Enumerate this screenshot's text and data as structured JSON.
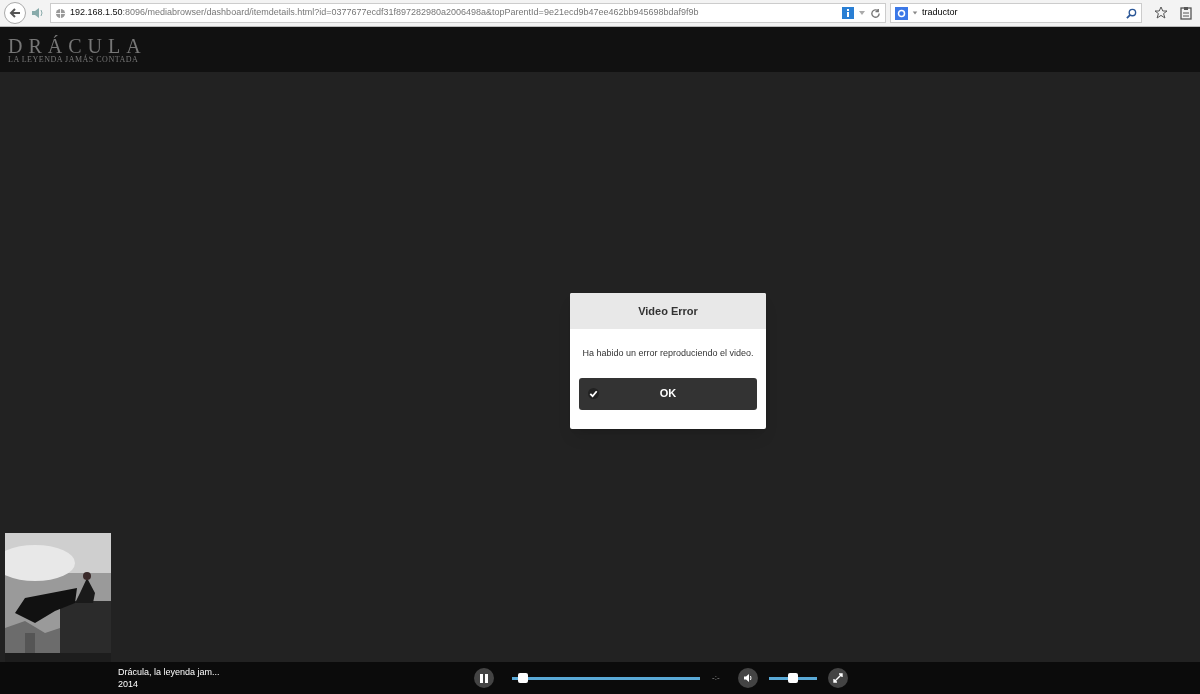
{
  "browser": {
    "url_host": "192.168.1.50",
    "url_rest": ":8096/mediabrowser/dashboard/itemdetails.html?id=0377677ecdf31f897282980a2006498a&topParentId=9e21ecd9b47ee462bb945698bdaf9f9b",
    "search_value": "traductor"
  },
  "header": {
    "logo_title": "DRÁCULA",
    "logo_tagline": "LA LEYENDA JAMÁS CONTADA"
  },
  "dialog": {
    "title": "Video Error",
    "message": "Ha habido un error reproduciendo el video.",
    "button": "OK"
  },
  "player": {
    "title": "Drácula, la leyenda jam...",
    "year": "2014",
    "playing": true,
    "progress": {
      "level": 0.06
    },
    "time": "-:-",
    "volume": {
      "level": 0.5
    }
  }
}
